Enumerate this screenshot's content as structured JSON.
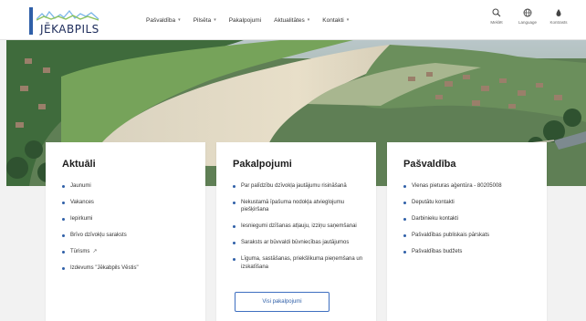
{
  "site": {
    "logo_text": "JĒKABPILS"
  },
  "nav": {
    "items": [
      {
        "label": "Pašvaldība",
        "has_dropdown": true
      },
      {
        "label": "Pilsēta",
        "has_dropdown": true
      },
      {
        "label": "Pakalpojumi",
        "has_dropdown": false
      },
      {
        "label": "Aktualitātes",
        "has_dropdown": true
      },
      {
        "label": "Kontakti",
        "has_dropdown": true
      }
    ]
  },
  "tools": {
    "search_label": "Meklēt",
    "language_label": "Language",
    "accessibility_label": "Kontrasts"
  },
  "cards": {
    "news": {
      "title": "Aktuāli",
      "items": [
        "Jaunumi",
        "Vakances",
        "Iepirkumi",
        "Brīvo dzīvokļu saraksts",
        "Tūrisms",
        "Izdevums \"Jēkabpils Vēstis\""
      ]
    },
    "services": {
      "title": "Pakalpojumi",
      "items": [
        "Par palīdzību dzīvokļa jautājumu risināšanā",
        "Nekustamā īpašuma nodokļa atvieglojumu piešķiršana",
        "Iesniegumi dzīšanas atļauju, izziņu saņemšanai",
        "Saraksts ar būvvaldi būvniecības jautājumos",
        "Līguma, sastāšanas, priekšlikuma pieņemšana un izskatīšana"
      ],
      "button_label": "Visi pakalpojumi"
    },
    "municipality": {
      "title": "Pašvaldība",
      "items": [
        "Vienas pieturas aģentūra - 80205008",
        "Deputātu kontakti",
        "Darbinieku kontakti",
        "Pašvaldības publiskais pārskats",
        "Pašvaldības budžets"
      ]
    }
  },
  "colors": {
    "accent": "#2f5fa8",
    "logo_text": "#1c2b5a"
  }
}
